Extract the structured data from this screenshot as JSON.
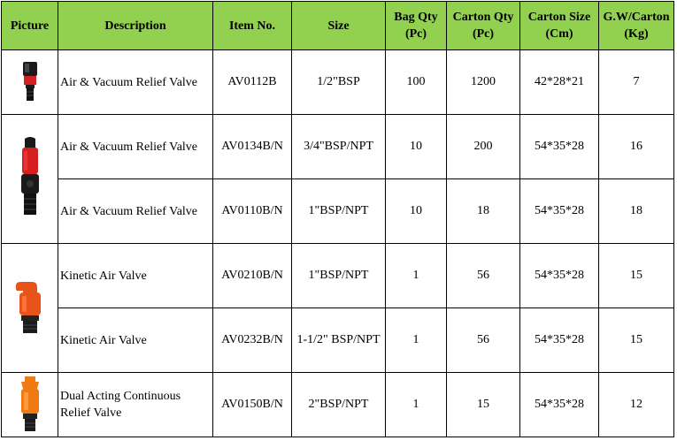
{
  "table": {
    "headers": {
      "picture": "Picture",
      "description": "Description",
      "item_no": "Item No.",
      "size": "Size",
      "bag_qty": "Bag Qty (Pc)",
      "carton_qty": "Carton  Qty (Pc)",
      "carton_size": "Carton  Size (Cm)",
      "gw_carton": "G.W/Carton (Kg)"
    },
    "rows": [
      {
        "description": "Air & Vacuum Relief Valve",
        "item_no": "AV0112B",
        "size": "1/2\"BSP",
        "bag_qty": "100",
        "carton_qty": "1200",
        "carton_size": "42*28*21",
        "gw": "7"
      },
      {
        "description": "Air & Vacuum Relief Valve",
        "item_no": "AV0134B/N",
        "size": "3/4\"BSP/NPT",
        "bag_qty": "10",
        "carton_qty": "200",
        "carton_size": "54*35*28",
        "gw": "16"
      },
      {
        "description": "Air & Vacuum Relief Valve",
        "item_no": "AV0110B/N",
        "size": "1\"BSP/NPT",
        "bag_qty": "10",
        "carton_qty": "18",
        "carton_size": "54*35*28",
        "gw": "18"
      },
      {
        "description": "Kinetic Air Valve",
        "item_no": "AV0210B/N",
        "size": "1\"BSP/NPT",
        "bag_qty": "1",
        "carton_qty": "56",
        "carton_size": "54*35*28",
        "gw": "15"
      },
      {
        "description": "Kinetic Air Valve",
        "item_no": "AV0232B/N",
        "size": "1-1/2\" BSP/NPT",
        "bag_qty": "1",
        "carton_qty": "56",
        "carton_size": "54*35*28",
        "gw": "15"
      },
      {
        "description": "Dual Acting Continuous Relief Valve",
        "item_no": "AV0150B/N",
        "size": "2\"BSP/NPT",
        "bag_qty": "1",
        "carton_qty": "15",
        "carton_size": "54*35*28",
        "gw": "12"
      }
    ],
    "pictures": [
      {
        "icon": "black-red-small-valve-icon",
        "colors": {
          "body": "#1a1a1a",
          "band": "#d42020"
        }
      },
      {
        "icon": "black-red-tall-valve-icon",
        "colors": {
          "body": "#1a1a1a",
          "band": "#d42020"
        }
      },
      {
        "icon": "orange-kinetic-valve-icon",
        "colors": {
          "body": "#e8531a",
          "base": "#222222"
        }
      },
      {
        "icon": "orange-dual-valve-icon",
        "colors": {
          "body": "#f07a12",
          "base": "#222222"
        }
      }
    ],
    "header_color": "#92d050"
  }
}
